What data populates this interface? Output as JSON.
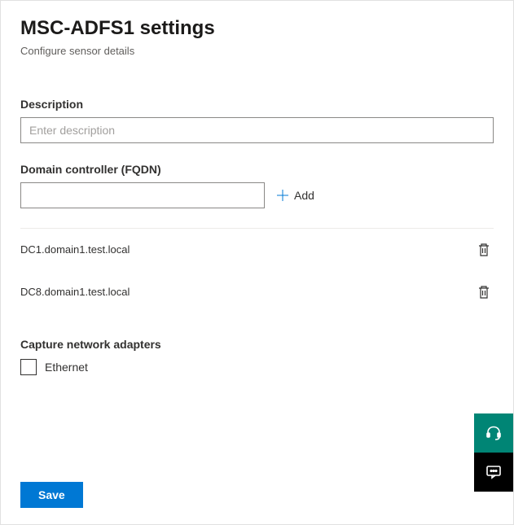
{
  "header": {
    "title": "MSC-ADFS1 settings",
    "subtitle": "Configure sensor details"
  },
  "description": {
    "label": "Description",
    "placeholder": "Enter description",
    "value": ""
  },
  "fqdn": {
    "label": "Domain controller (FQDN)",
    "value": "",
    "add_label": "Add"
  },
  "dc_list": [
    {
      "name": "DC1.domain1.test.local"
    },
    {
      "name": "DC8.domain1.test.local"
    }
  ],
  "adapters": {
    "label": "Capture network adapters",
    "items": [
      {
        "label": "Ethernet",
        "checked": false
      }
    ]
  },
  "actions": {
    "save_label": "Save"
  }
}
